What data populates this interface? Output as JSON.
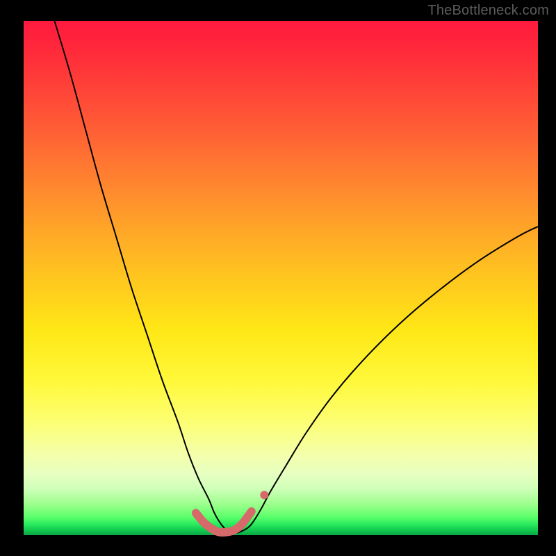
{
  "attribution": "TheBottleneck.com",
  "chart_data": {
    "type": "line",
    "title": "",
    "xlabel": "",
    "ylabel": "",
    "xlim": [
      0,
      100
    ],
    "ylim": [
      0,
      100
    ],
    "background_gradient": {
      "direction": "vertical",
      "stops": [
        {
          "pos": 0,
          "color": "#ff1a3e"
        },
        {
          "pos": 20,
          "color": "#ff5a36"
        },
        {
          "pos": 46,
          "color": "#ffb923"
        },
        {
          "pos": 70,
          "color": "#fff83a"
        },
        {
          "pos": 88,
          "color": "#e8ffc0"
        },
        {
          "pos": 100,
          "color": "#0aa845"
        }
      ]
    },
    "series": [
      {
        "name": "main-curve",
        "color": "#000000",
        "width": 2,
        "x": [
          6,
          9,
          12,
          15,
          18,
          21,
          24,
          27,
          30,
          32,
          34,
          36,
          37,
          38,
          39,
          40,
          41,
          42,
          44,
          46,
          48,
          51,
          55,
          60,
          66,
          73,
          80,
          88,
          96,
          100
        ],
        "y": [
          100,
          90,
          79,
          68,
          58,
          48,
          39,
          30,
          22,
          16,
          11,
          7,
          4.5,
          2.7,
          1.4,
          0.6,
          0.4,
          0.6,
          1.8,
          4.8,
          8.5,
          13.5,
          20,
          27,
          34,
          41,
          47,
          53,
          58,
          60
        ]
      },
      {
        "name": "bottom-red-highlight",
        "color": "#d66a6a",
        "width": 12,
        "linecap": "round",
        "x": [
          33.5,
          35,
          36.5,
          38,
          39.5,
          41,
          42.5,
          44.3
        ],
        "y": [
          4.3,
          2.5,
          1.3,
          0.6,
          0.6,
          1.0,
          2.2,
          4.6
        ]
      },
      {
        "name": "highlight-end-dot",
        "type": "scatter",
        "color": "#d66a6a",
        "size": 12,
        "x": [
          46.8
        ],
        "y": [
          7.8
        ]
      }
    ]
  }
}
